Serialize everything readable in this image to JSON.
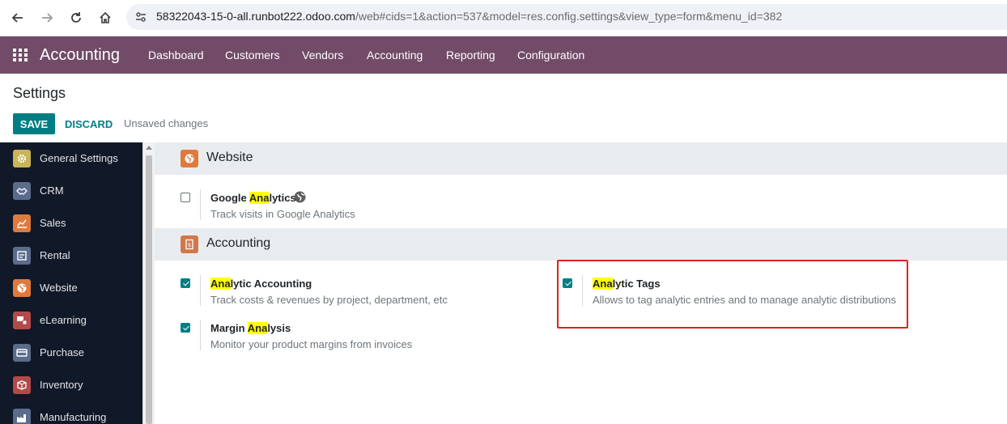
{
  "browser": {
    "url_host": "58322043-15-0-all.runbot222.odoo.com",
    "url_rest": "/web#cids=1&action=537&model=res.config.settings&view_type=form&menu_id=382"
  },
  "topnav": {
    "app_title": "Accounting",
    "menu": [
      "Dashboard",
      "Customers",
      "Vendors",
      "Accounting",
      "Reporting",
      "Configuration"
    ]
  },
  "control_panel": {
    "title": "Settings",
    "save_label": "SAVE",
    "discard_label": "DISCARD",
    "status": "Unsaved changes"
  },
  "sidebar": {
    "items": [
      {
        "label": "General Settings",
        "icon": "gear-icon",
        "color": "#c9b458"
      },
      {
        "label": "CRM",
        "icon": "handshake-icon",
        "color": "#5b6b8c"
      },
      {
        "label": "Sales",
        "icon": "chart-icon",
        "color": "#e07a3c"
      },
      {
        "label": "Rental",
        "icon": "rental-icon",
        "color": "#5b6b8c"
      },
      {
        "label": "Website",
        "icon": "globe-icon",
        "color": "#e07a3c"
      },
      {
        "label": "eLearning",
        "icon": "elearning-icon",
        "color": "#b34a4a"
      },
      {
        "label": "Purchase",
        "icon": "card-icon",
        "color": "#5b6b8c"
      },
      {
        "label": "Inventory",
        "icon": "box-icon",
        "color": "#b34a4a"
      },
      {
        "label": "Manufacturing",
        "icon": "factory-icon",
        "color": "#5b6b8c"
      }
    ]
  },
  "sections": {
    "website": {
      "title": "Website",
      "settings": {
        "google_analytics": {
          "title_hl": "Ana",
          "title_pre": "Google ",
          "title_post": "lytics",
          "desc": "Track visits in Google Analytics",
          "checked": false
        }
      }
    },
    "accounting": {
      "title": "Accounting",
      "settings": {
        "analytic_accounting": {
          "title_hl": "Ana",
          "title_post": "lytic Accounting",
          "desc": "Track costs & revenues by project, department, etc",
          "checked": true
        },
        "analytic_tags": {
          "title_hl": "Ana",
          "title_post": "lytic Tags",
          "desc": "Allows to tag analytic entries and to manage analytic distributions",
          "checked": true
        },
        "margin_analysis": {
          "title_pre": "Margin ",
          "title_hl": "Ana",
          "title_post": "lysis",
          "desc": "Monitor your product margins from invoices",
          "checked": true
        }
      }
    }
  },
  "colors": {
    "brand": "#714b67",
    "primary": "#017e84",
    "highlight": "#ffff00",
    "annotation": "#e02020"
  }
}
